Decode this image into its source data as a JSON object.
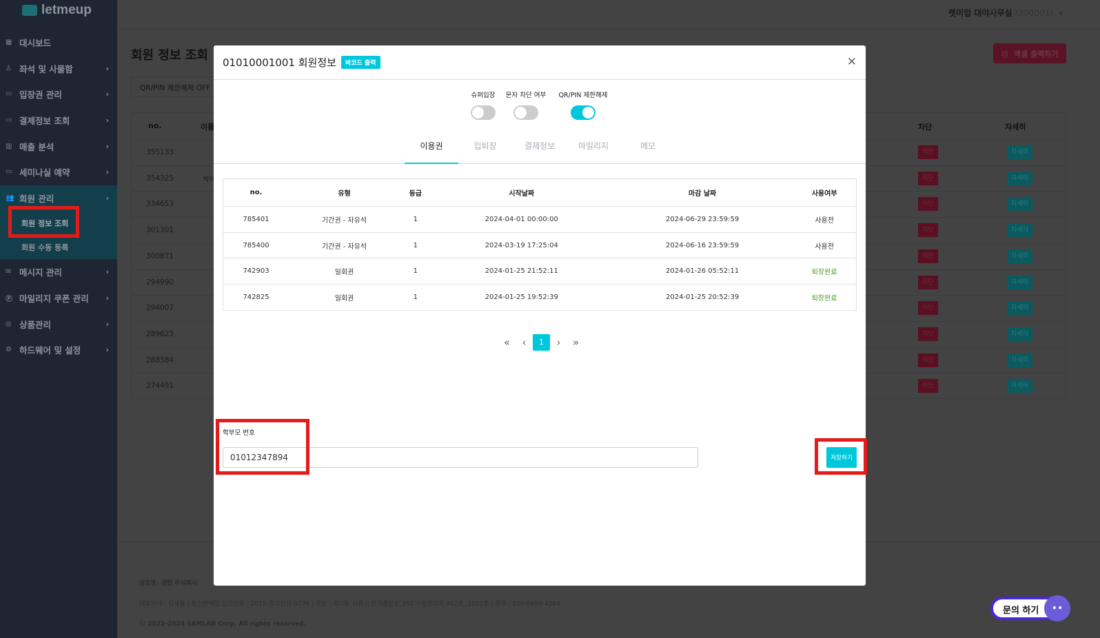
{
  "brand": "letmeup",
  "account": {
    "name": "렛미업 대야사무실",
    "code": "(300001)"
  },
  "sidebar": {
    "items": [
      {
        "label": "대시보드",
        "icon": "grid-icon"
      },
      {
        "label": "좌석 및 사물함",
        "icon": "seat-icon"
      },
      {
        "label": "입장권 관리",
        "icon": "ticket-icon"
      },
      {
        "label": "결제정보 조회",
        "icon": "card-icon"
      },
      {
        "label": "매출 분석",
        "icon": "chart-icon"
      },
      {
        "label": "세미나실 예약",
        "icon": "calendar-icon"
      },
      {
        "label": "회원 관리",
        "icon": "users-icon"
      },
      {
        "label": "메시지 관리",
        "icon": "mail-icon"
      },
      {
        "label": "마일리지 쿠폰 관리",
        "icon": "coin-icon"
      },
      {
        "label": "상품관리",
        "icon": "bag-icon"
      },
      {
        "label": "하드웨어 및 설정",
        "icon": "gear-icon"
      }
    ],
    "sub": [
      "회원 정보 조회",
      "회원 수동 등록"
    ]
  },
  "page": {
    "title": "회원 정보 조회",
    "filter": "QR/PIN 제한해제 OFF",
    "excel": "엑셀 출력하기",
    "table": {
      "headers": [
        "no.",
        "이름",
        "차단",
        "자세히"
      ],
      "block_label": "차단",
      "detail_label": "자세히",
      "rows": [
        {
          "no": "355133",
          "name": ""
        },
        {
          "no": "354325",
          "name": "박이"
        },
        {
          "no": "334653",
          "name": ""
        },
        {
          "no": "301301",
          "name": ""
        },
        {
          "no": "300871",
          "name": ""
        },
        {
          "no": "294990",
          "name": ""
        },
        {
          "no": "294007",
          "name": ""
        },
        {
          "no": "289623",
          "name": ""
        },
        {
          "no": "288584",
          "name": ""
        },
        {
          "no": "274491",
          "name": ""
        }
      ]
    }
  },
  "footer": {
    "company": "상호명: 샘랩 주식회사",
    "info": "대표이사 : 심세용  |  통신판매업 신고번호 : 2019-경기안산-0776  |  주소 : 경기도 시흥시 은계중앙로 362 수림프라자 902호 ,1001호  |  문의 : 010-6659-4264",
    "copyright": "ⓒ 2022-2024 SAMLAB Corp. All rights reserved."
  },
  "modal": {
    "title": "01010001001 회원정보",
    "barcode": "바코드 출력",
    "toggles": [
      {
        "label": "슈퍼입장",
        "on": false
      },
      {
        "label": "문자 차단 여부",
        "on": false
      },
      {
        "label": "QR/PIN 제한해제",
        "on": true
      }
    ],
    "tabs": [
      "이용권",
      "입퇴장",
      "결제정보",
      "마일리지",
      "메모"
    ],
    "table": {
      "headers": [
        "no.",
        "유형",
        "등급",
        "시작날짜",
        "마감 날짜",
        "사용여부"
      ],
      "rows": [
        [
          "785401",
          "기간권 - 자유석",
          "1",
          "2024-04-01 00:00:00",
          "2024-06-29 23:59:59",
          "사용전"
        ],
        [
          "785400",
          "기간권 - 자유석",
          "1",
          "2024-03-19 17:25:04",
          "2024-06-16 23:59:59",
          "사용전"
        ],
        [
          "742903",
          "일회권",
          "1",
          "2024-01-25 21:52:11",
          "2024-01-26 05:52:11",
          "퇴장완료"
        ],
        [
          "742825",
          "일회권",
          "1",
          "2024-01-25 19:52:39",
          "2024-01-25 20:52:39",
          "퇴장완료"
        ]
      ]
    },
    "pagination": {
      "current": "1"
    },
    "parent_label": "학부모 번호",
    "parent_value": "01012347894",
    "save": "저장하기"
  },
  "chat": {
    "label": "문의 하기"
  },
  "colors": {
    "accent": "#00c8dc",
    "highlight": "#e31b1b",
    "done": "#4c9a2a"
  }
}
